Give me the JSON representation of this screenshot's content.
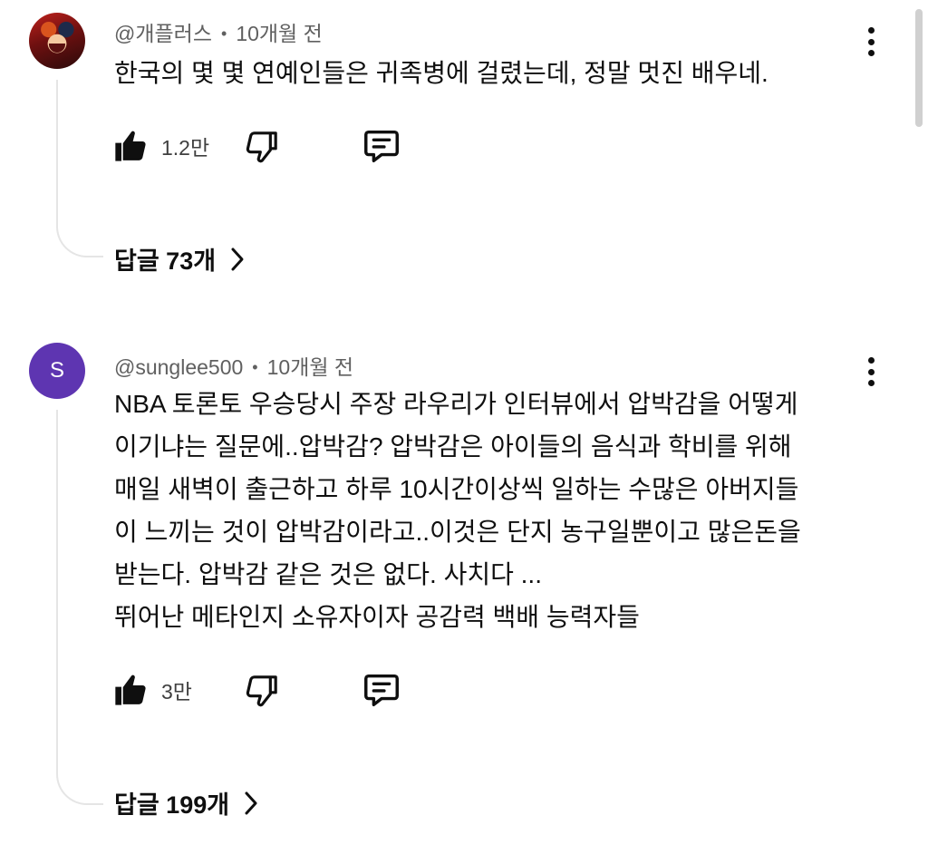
{
  "comments": [
    {
      "author": "@개플러스",
      "time": "10개월 전",
      "text_lines": [
        "한국의 몇 몇 연예인들은 귀족병에 걸렸는데, 정말 멋진 배우네."
      ],
      "likes": "1.2만",
      "replies": "답글 73개",
      "avatar": "movie-poster-avatar"
    },
    {
      "author": "@sunglee500",
      "time": "10개월 전",
      "text_lines": [
        "NBA 토론토 우승당시 주장 라우리가 인터뷰에서 압박감을 어떻게",
        "이기냐는 질문에..압박감? 압박감은 아이들의 음식과 학비를 위해",
        "매일 새벽이 출근하고 하루 10시간이상씩 일하는 수많은 아버지들",
        "이 느끼는 것이 압박감이라고..이것은 단지 농구일뿐이고 많은돈을",
        "받는다. 압박감 같은 것은 없다. 사치다 ...",
        "뛰어난 메타인지 소유자이자 공감력 백배 능력자들"
      ],
      "likes": "3만",
      "replies": "답글 199개",
      "avatar_letter": "S",
      "avatar_color": "#5e35b1"
    }
  ],
  "meta_separator": "•",
  "icons": {
    "like": "thumbs-up-icon",
    "dislike": "thumbs-down-icon",
    "reply": "comment-icon",
    "more": "more-vertical-icon",
    "expand": "chevron-right-icon"
  }
}
